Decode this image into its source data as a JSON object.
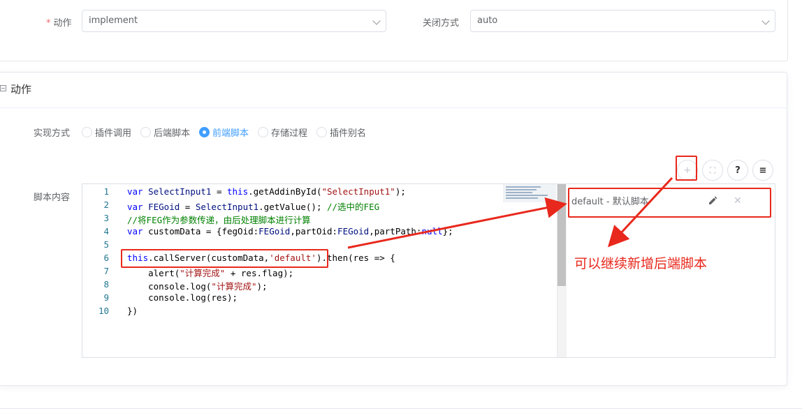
{
  "form": {
    "action_label": "动作",
    "action_value": "implement",
    "close_label": "关闭方式",
    "close_value": "auto"
  },
  "section": {
    "title": "动作",
    "impl_label": "实现方式",
    "radios": [
      {
        "label": "插件调用",
        "checked": false
      },
      {
        "label": "后端脚本",
        "checked": false
      },
      {
        "label": "前端脚本",
        "checked": true
      },
      {
        "label": "存储过程",
        "checked": false
      },
      {
        "label": "插件别名",
        "checked": false
      }
    ],
    "script_label": "脚本内容"
  },
  "toolbar": {
    "add": "+",
    "fullscreen": "⛶",
    "help": "?",
    "format": "≡"
  },
  "editor": {
    "line_numbers": [
      "1",
      "2",
      "3",
      "4",
      "5",
      "6",
      "7",
      "8",
      "9",
      "10"
    ]
  },
  "script_list": {
    "items": [
      {
        "name": "default - 默认脚本"
      }
    ]
  },
  "annotation": {
    "text": "可以继续新增后端脚本",
    "color": "#e8281c"
  },
  "colors": {
    "accent": "#409eff",
    "required": "#f56c6c"
  }
}
